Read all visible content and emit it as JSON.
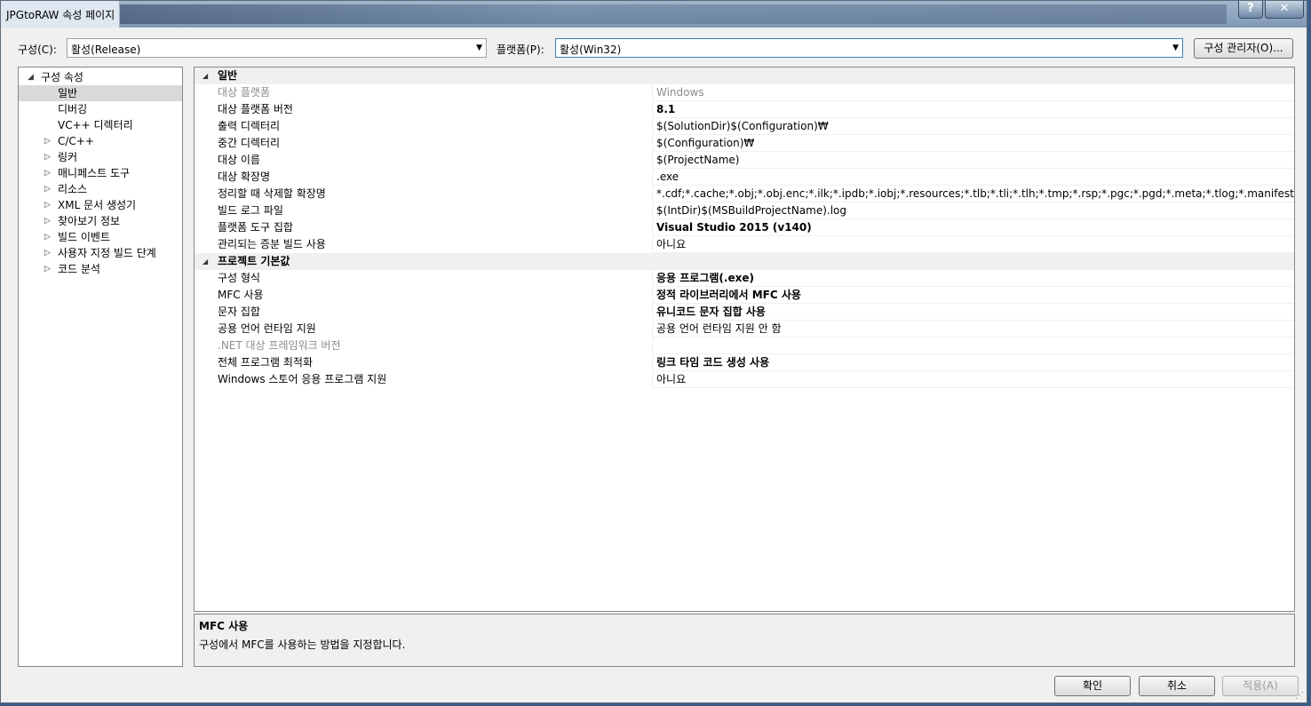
{
  "window": {
    "title": "JPGtoRAW 속성 페이지",
    "help_label": "?",
    "close_label": "✕"
  },
  "config_bar": {
    "config_label": "구성(C):",
    "config_value": "활성(Release)",
    "platform_label": "플랫폼(P):",
    "platform_value": "활성(Win32)",
    "manager_button": "구성 관리자(O)..."
  },
  "tree": {
    "root": "구성 속성",
    "items": [
      {
        "label": "일반",
        "expandable": false,
        "selected": true
      },
      {
        "label": "디버깅",
        "expandable": false,
        "selected": false
      },
      {
        "label": "VC++ 디렉터리",
        "expandable": false,
        "selected": false
      },
      {
        "label": "C/C++",
        "expandable": true,
        "selected": false
      },
      {
        "label": "링커",
        "expandable": true,
        "selected": false
      },
      {
        "label": "매니페스트 도구",
        "expandable": true,
        "selected": false
      },
      {
        "label": "리소스",
        "expandable": true,
        "selected": false
      },
      {
        "label": "XML 문서 생성기",
        "expandable": true,
        "selected": false
      },
      {
        "label": "찾아보기 정보",
        "expandable": true,
        "selected": false
      },
      {
        "label": "빌드 이벤트",
        "expandable": true,
        "selected": false
      },
      {
        "label": "사용자 지정 빌드 단계",
        "expandable": true,
        "selected": false
      },
      {
        "label": "코드 분석",
        "expandable": true,
        "selected": false
      }
    ]
  },
  "grid": {
    "categories": [
      {
        "name": "일반",
        "rows": [
          {
            "name": "대상 플랫폼",
            "value": "Windows",
            "bold": false,
            "dim": true
          },
          {
            "name": "대상 플랫폼 버전",
            "value": "8.1",
            "bold": true,
            "dim": false
          },
          {
            "name": "출력 디렉터리",
            "value": "$(SolutionDir)$(Configuration)₩",
            "bold": false,
            "dim": false
          },
          {
            "name": "중간 디렉터리",
            "value": "$(Configuration)₩",
            "bold": false,
            "dim": false
          },
          {
            "name": "대상 이름",
            "value": "$(ProjectName)",
            "bold": false,
            "dim": false
          },
          {
            "name": "대상 확장명",
            "value": ".exe",
            "bold": false,
            "dim": false
          },
          {
            "name": "정리할 때 삭제할 확장명",
            "value": "*.cdf;*.cache;*.obj;*.obj.enc;*.ilk;*.ipdb;*.iobj;*.resources;*.tlb;*.tli;*.tlh;*.tmp;*.rsp;*.pgc;*.pgd;*.meta;*.tlog;*.manifest;*.res;*.pch;*.exp;*.i",
            "bold": false,
            "dim": false
          },
          {
            "name": "빌드 로그 파일",
            "value": "$(IntDir)$(MSBuildProjectName).log",
            "bold": false,
            "dim": false
          },
          {
            "name": "플랫폼 도구 집합",
            "value": "Visual Studio 2015 (v140)",
            "bold": true,
            "dim": false
          },
          {
            "name": "관리되는 증분 빌드 사용",
            "value": "아니요",
            "bold": false,
            "dim": false
          }
        ]
      },
      {
        "name": "프로젝트 기본값",
        "rows": [
          {
            "name": "구성 형식",
            "value": "응용 프로그램(.exe)",
            "bold": true,
            "dim": false
          },
          {
            "name": "MFC 사용",
            "value": "정적 라이브러리에서 MFC 사용",
            "bold": true,
            "dim": false
          },
          {
            "name": "문자 집합",
            "value": "유니코드 문자 집합 사용",
            "bold": true,
            "dim": false
          },
          {
            "name": "공용 언어 런타임 지원",
            "value": "공용 언어 런타임 지원 안 함",
            "bold": false,
            "dim": false
          },
          {
            "name": ".NET 대상 프레임워크 버전",
            "value": "",
            "bold": false,
            "dim": true
          },
          {
            "name": "전체 프로그램 최적화",
            "value": "링크 타임 코드 생성 사용",
            "bold": true,
            "dim": false
          },
          {
            "name": "Windows 스토어 응용 프로그램 지원",
            "value": "아니요",
            "bold": false,
            "dim": false
          }
        ]
      }
    ]
  },
  "description": {
    "title": "MFC 사용",
    "text": "구성에서 MFC를 사용하는 방법을 지정합니다."
  },
  "footer": {
    "ok": "확인",
    "cancel": "취소",
    "apply": "적용(A)"
  }
}
